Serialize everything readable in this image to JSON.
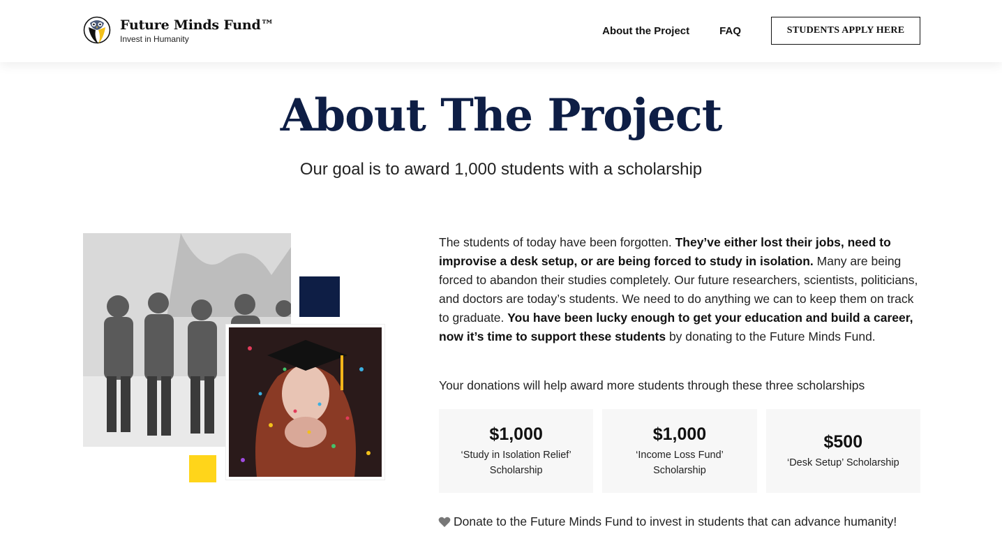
{
  "header": {
    "logo_name": "Future Minds Fund™",
    "logo_tagline": "Invest in Humanity",
    "nav": {
      "about": "About the Project",
      "faq": "FAQ",
      "cta": "STUDENTS APPLY HERE"
    }
  },
  "hero": {
    "title": "About The Project",
    "subtitle": "Our goal is to award 1,000 students with a scholarship"
  },
  "intro": {
    "p1": "The students of today have been forgotten. ",
    "b1": "They’ve either lost their jobs, need to improvise a desk setup, or are being forced to study in isolation.",
    "p2": " Many are being forced to abandon their studies completely. Our future researchers, scientists, politicians, and doctors are today’s students. We need to do anything we can to keep them on track to graduate. ",
    "b2": "You have been lucky enough to get your education and build a career, now it’s time to support these students",
    "p3": " by donating to the Future Minds Fund."
  },
  "donations_lead": "Your donations will help award more students through these three scholarships",
  "scholarships": [
    {
      "amount": "$1,000",
      "name": "‘Study in Isolation Relief’ Scholarship"
    },
    {
      "amount": "$1,000",
      "name": "‘Income Loss Fund’ Scholarship"
    },
    {
      "amount": "$500",
      "name": "‘Desk Setup’ Scholarship"
    }
  ],
  "donate_line": "Donate to the Future Minds Fund to invest in students that can advance humanity!",
  "colors": {
    "navy": "#0e1e45",
    "yellow": "#ffd51a",
    "card_bg": "#f7f7f7"
  },
  "icons": {
    "logo": "owl-logo-icon",
    "heart": "heart-icon"
  }
}
